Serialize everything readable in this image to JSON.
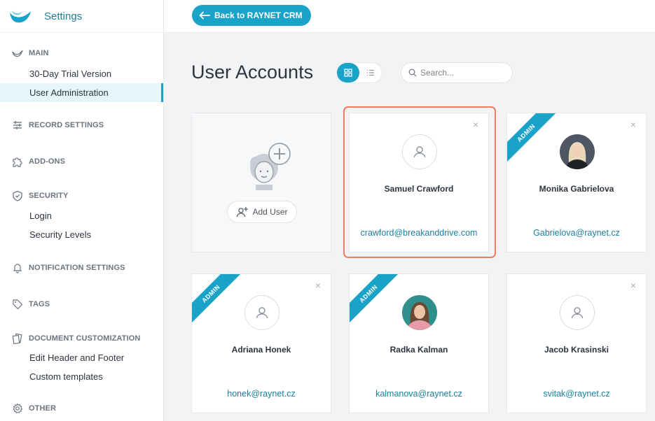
{
  "brand": {
    "title": "Settings"
  },
  "sidebar": {
    "sections": [
      {
        "label": "MAIN",
        "icon": "raynet-logo-icon",
        "items": [
          "30-Day Trial Version",
          "User Administration"
        ]
      },
      {
        "label": "RECORD SETTINGS",
        "icon": "sliders-icon",
        "items": []
      },
      {
        "label": "ADD-ONS",
        "icon": "puzzle-icon",
        "items": []
      },
      {
        "label": "SECURITY",
        "icon": "shield-icon",
        "items": [
          "Login",
          "Security Levels"
        ]
      },
      {
        "label": "NOTIFICATION SETTINGS",
        "icon": "bell-icon",
        "items": []
      },
      {
        "label": "TAGS",
        "icon": "tag-icon",
        "items": []
      },
      {
        "label": "DOCUMENT CUSTOMIZATION",
        "icon": "documents-icon",
        "items": [
          "Edit Header and Footer",
          "Custom templates"
        ]
      },
      {
        "label": "OTHER",
        "icon": "gear-icon",
        "items": []
      }
    ],
    "active_item": "User Administration"
  },
  "topbar": {
    "back_label": "Back to RAYNET CRM"
  },
  "main": {
    "title": "User Accounts",
    "search_placeholder": "Search...",
    "add_user_label": "Add User",
    "admin_badge": "ADMIN",
    "close_glyph": "×",
    "users": [
      {
        "name": "Samuel Crawford",
        "email": "crawford@breakanddrive.com",
        "admin": false,
        "photo": false,
        "selected": true
      },
      {
        "name": "Monika Gabrielova",
        "email": "Gabrielova@raynet.cz",
        "admin": true,
        "photo": true
      },
      {
        "name": "Adriana Honek",
        "email": "honek@raynet.cz",
        "admin": true,
        "photo": false
      },
      {
        "name": "Radka Kalman",
        "email": "kalmanova@raynet.cz",
        "admin": true,
        "photo": true
      },
      {
        "name": "Jacob Krasinski",
        "email": "svitak@raynet.cz",
        "admin": false,
        "photo": false
      }
    ]
  },
  "colors": {
    "accent": "#1aa3c8",
    "link": "#1a7f9c",
    "selection": "#ee7d62"
  }
}
